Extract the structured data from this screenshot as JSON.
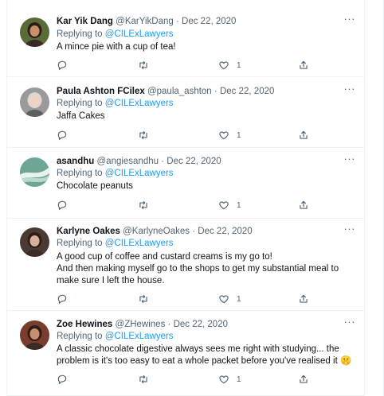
{
  "tweets": [
    {
      "name": "Kar Yik Dang",
      "handle": "@KarYikDang",
      "date": "Dec 22, 2020",
      "replying_prefix": "Replying to",
      "replying_to": "@CILExLawyers",
      "text": [
        "A mince pie with a cup of tea!"
      ],
      "likes": "1",
      "avatar_color": "#5a6b3a"
    },
    {
      "name": "Paula Ashton FCilex",
      "handle": "@paula_ashton",
      "date": "Dec 22, 2020",
      "replying_prefix": "Replying to",
      "replying_to": "@CILExLawyers",
      "text": [
        "Jaffa Cakes"
      ],
      "likes": "1",
      "avatar_color": "#9a9a9a"
    },
    {
      "name": "asandhu",
      "handle": "@angiesandhu",
      "date": "Dec 22, 2020",
      "replying_prefix": "Replying to",
      "replying_to": "@CILExLawyers",
      "text": [
        "Chocolate peanuts"
      ],
      "likes": "1",
      "avatar_color": "#6fa596"
    },
    {
      "name": "Karlyne Oakes",
      "handle": "@KarlyneOakes",
      "date": "Dec 22, 2020",
      "replying_prefix": "Replying to",
      "replying_to": "@CILExLawyers",
      "text": [
        "A good cup of coffee and custard creams is my go to!",
        "And then making myself go to the shops to get my substantial meal to",
        "make sure I left the house."
      ],
      "likes": "1",
      "avatar_color": "#4b3a34"
    },
    {
      "name": "Zoe Hewines",
      "handle": "@ZHewines",
      "date": "Dec 22, 2020",
      "replying_prefix": "Replying to",
      "replying_to": "@CILExLawyers",
      "text": [
        "A classic chocolate digestive always sees me right with studying... the",
        "problem is it's too easy to eat a whole packet before you've realised it 🤫"
      ],
      "likes": "1",
      "avatar_color": "#7a3c2c"
    }
  ],
  "separator": "·",
  "more_icon": "···",
  "colors": {
    "link": "#1d9bf0",
    "muted": "#536471"
  }
}
